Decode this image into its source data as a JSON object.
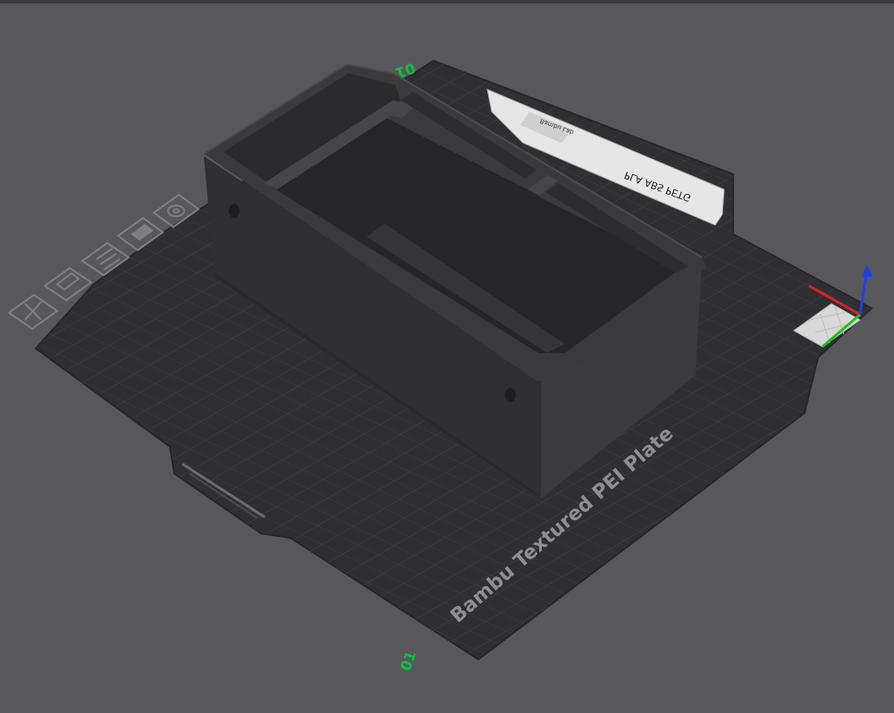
{
  "viewport": {
    "plate_name": "Bambu Textured PEI Plate",
    "plate_number_top": "01",
    "plate_number_bottom": "01",
    "filament_label": "PLA ABS PETG",
    "plate_tag": "Bambu Lab"
  },
  "plate_toolbar": {
    "icons": [
      "close-icon",
      "edit-plate-icon",
      "arrange-icon",
      "lock-icon",
      "settings-icon"
    ]
  },
  "axes": {
    "x_color": "#e02020",
    "y_color": "#20c020",
    "z_color": "#2040e0"
  },
  "colors": {
    "background": "#58585c",
    "plate": "#2f2f33",
    "grid": "#46464b",
    "model": "#333336"
  }
}
